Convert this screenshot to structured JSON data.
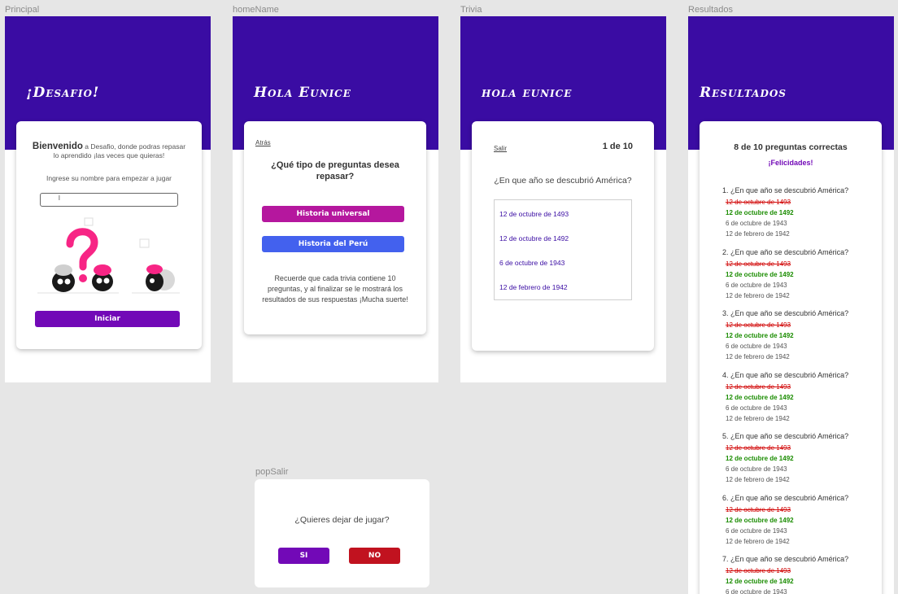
{
  "frames": {
    "principal": {
      "label": "Principal",
      "title": "¡Desafio!"
    },
    "home": {
      "label": "homeName",
      "title": "Hola Eunice"
    },
    "trivia": {
      "label": "Trivia",
      "title": "hola eunice"
    },
    "resultados": {
      "label": "Resultados",
      "title": "Resultados"
    },
    "popSalir": {
      "label": "popSalir"
    }
  },
  "principal": {
    "welcome_bold": "Bienvenido",
    "welcome_rest": " a Desafio, donde podras repasar lo aprendido ¡las veces que quieras!",
    "instruction": "Ingrese su nombre para empezar a jugar",
    "name_value": "l",
    "start_button": "Iniciar"
  },
  "home": {
    "back_link": "Atrás",
    "question": "¿Qué tipo de preguntas desea repasar?",
    "btn_universal": "Historia universal",
    "btn_peru": "Historia del Perú",
    "note": "Recuerde que cada trivia contiene 10 preguntas, y al finalizar se le mostrará los resultados de sus respuestas ¡Mucha suerte!"
  },
  "trivia": {
    "exit_link": "Salir",
    "counter": "1 de 10",
    "question": "¿En que año se descubrió América?",
    "options": [
      "12 de octubre de 1493",
      "12 de octubre de 1492",
      "6 de octubre de 1943",
      "12 de febrero de 1942"
    ]
  },
  "resultados": {
    "score": "8 de 10 preguntas correctas",
    "congrats": "¡Felicidades!",
    "items": [
      {
        "q": "1. ¿En que año se descubrió América?",
        "wrong": "12 de octubre de 1493",
        "correct": "12 de octubre de 1492",
        "o1": "6 de octubre de 1943",
        "o2": "12 de febrero de 1942"
      },
      {
        "q": "2. ¿En que año se descubrió América?",
        "wrong": "12 de octubre de 1493",
        "correct": "12 de octubre de 1492",
        "o1": "6 de octubre de 1943",
        "o2": "12 de febrero de 1942"
      },
      {
        "q": "3. ¿En que año se descubrió América?",
        "wrong": "12 de octubre de 1493",
        "correct": "12 de octubre de 1492",
        "o1": "6 de octubre de 1943",
        "o2": "12 de febrero de 1942"
      },
      {
        "q": "4. ¿En que año se descubrió América?",
        "wrong": "12 de octubre de 1493",
        "correct": "12 de octubre de 1492",
        "o1": "6 de octubre de 1943",
        "o2": "12 de febrero de 1942"
      },
      {
        "q": "5. ¿En que año se descubrió América?",
        "wrong": "12 de octubre de 1493",
        "correct": "12 de octubre de 1492",
        "o1": "6 de octubre de 1943",
        "o2": "12 de febrero de 1942"
      },
      {
        "q": "6. ¿En que año se descubrió América?",
        "wrong": "12 de octubre de 1493",
        "correct": "12 de octubre de 1492",
        "o1": "6 de octubre de 1943",
        "o2": "12 de febrero de 1942"
      },
      {
        "q": "7. ¿En que año se descubrió América?",
        "wrong": "12 de octubre de 1493",
        "correct": "12 de octubre de 1492",
        "o1": "6 de octubre de 1943",
        "o2": ""
      }
    ]
  },
  "popSalir": {
    "question": "¿Quieres dejar de jugar?",
    "yes": "SI",
    "no": "NO"
  },
  "colors": {
    "header_band": "#3a0ca3",
    "primary_button": "#7209b7",
    "magenta_button": "#b5179e",
    "blue_button": "#4361ee",
    "no_button": "#c1121f",
    "correct": "#1a8c00",
    "wrong": "#d00000",
    "canvas": "#e6e6e6"
  },
  "icons": [
    "illustration-characters"
  ]
}
